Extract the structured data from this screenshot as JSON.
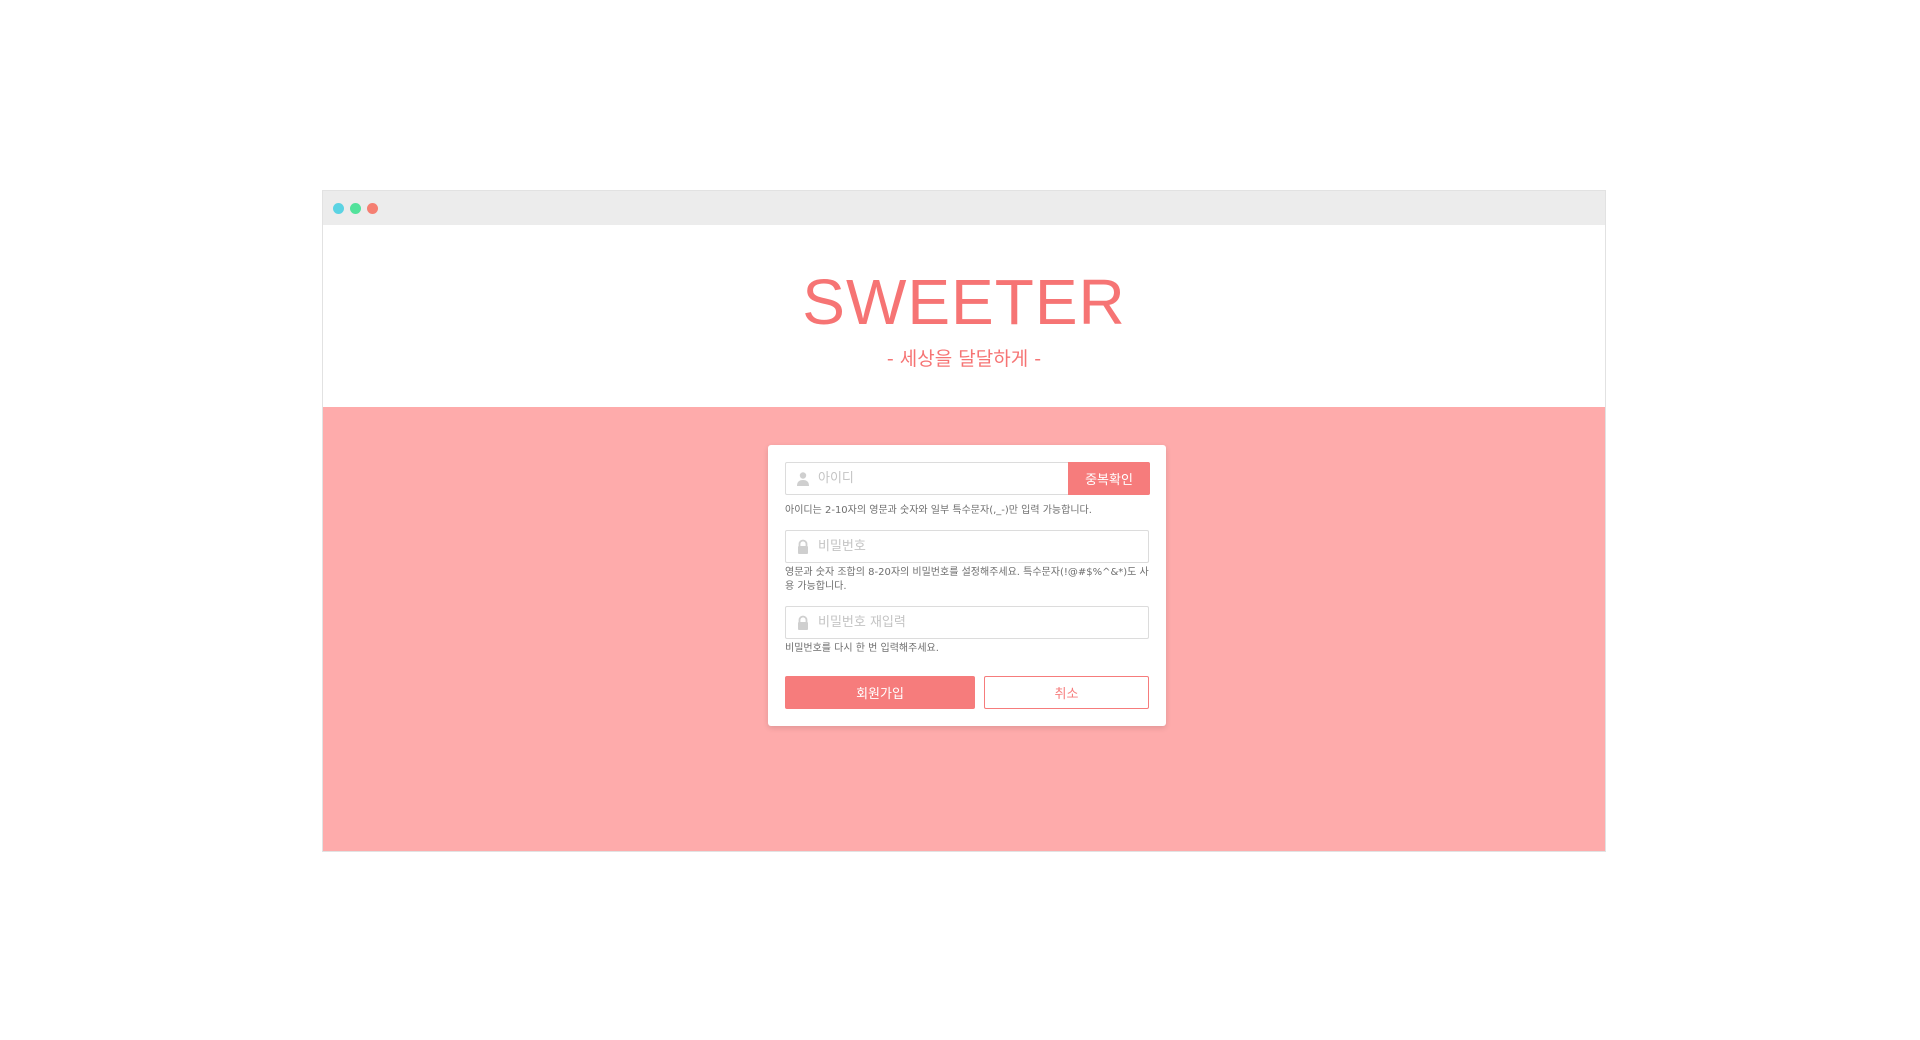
{
  "window": {
    "controls": [
      "close-dot",
      "minimize-dot",
      "maximize-dot"
    ]
  },
  "header": {
    "logo": "SWEETER",
    "slogan": "- 세상을 달달하게 -"
  },
  "form": {
    "id_field": {
      "placeholder": "아이디",
      "icon": "user-icon",
      "check_button": "중복확인",
      "hint": "아이디는 2-10자의 영문과 숫자와 일부 특수문자(,_-)만 입력 가능합니다."
    },
    "password_field": {
      "placeholder": "비밀번호",
      "icon": "lock-icon",
      "hint": "영문과 숫자 조합의 8-20자의 비밀번호를 설정해주세요. 특수문자(!@#$%^&*)도 사용 가능합니다."
    },
    "password_confirm_field": {
      "placeholder": "비밀번호 재입력",
      "icon": "lock-icon",
      "hint": "비밀번호를 다시 한 번 입력해주세요."
    },
    "submit_button": "회원가입",
    "cancel_button": "취소"
  },
  "colors": {
    "brand": "#f67474",
    "background_pink": "#feabab",
    "button": "#f67c7c"
  }
}
